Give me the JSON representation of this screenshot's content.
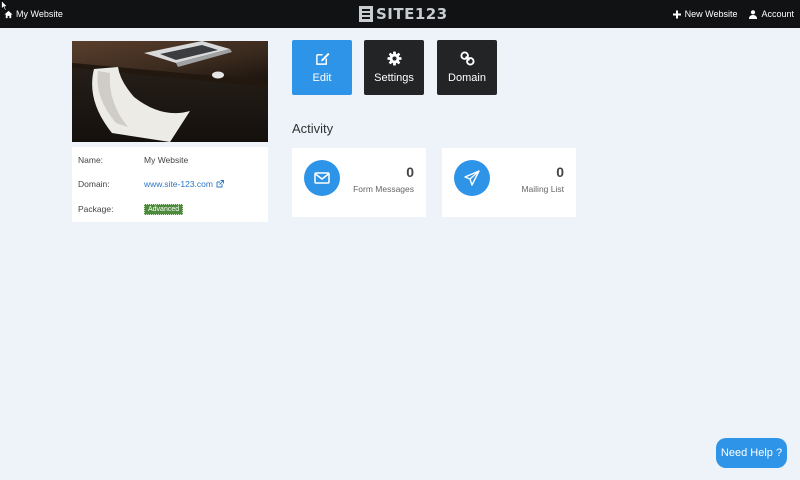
{
  "topbar": {
    "site_name": "My Website",
    "brand": "SITE123",
    "new_website": "New Website",
    "account": "Account"
  },
  "info": {
    "name_label": "Name:",
    "name_value": "My Website",
    "domain_label": "Domain:",
    "domain_value": "www.site-123.com",
    "package_label": "Package:",
    "package_value": "Advanced"
  },
  "actions": {
    "edit": "Edit",
    "settings": "Settings",
    "domain": "Domain"
  },
  "activity": {
    "title": "Activity",
    "form_messages": {
      "count": "0",
      "label": "Form Messages"
    },
    "mailing_list": {
      "count": "0",
      "label": "Mailing List"
    }
  },
  "help": "Need Help ?",
  "colors": {
    "accent": "#2e94e8",
    "dark": "#222426",
    "topbar": "#101214",
    "background": "#eef3f9"
  }
}
